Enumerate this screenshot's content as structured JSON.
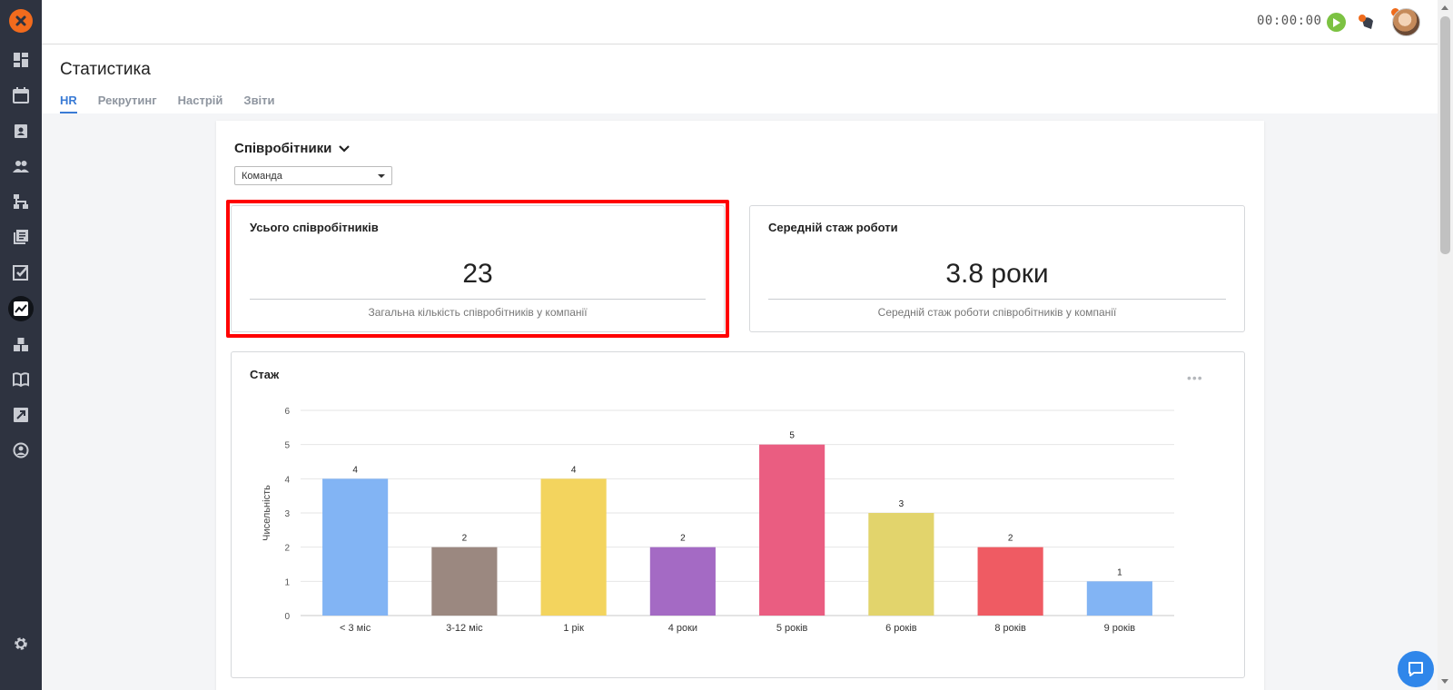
{
  "topbar": {
    "timer": "00:00:00"
  },
  "header": {
    "title": "Статистика",
    "tabs": [
      {
        "label": "HR",
        "active": true
      },
      {
        "label": "Рекрутинг",
        "active": false
      },
      {
        "label": "Настрій",
        "active": false
      },
      {
        "label": "Звіти",
        "active": false
      }
    ]
  },
  "filters": {
    "section_label": "Співробітники",
    "team_select_value": "Команда"
  },
  "stats": {
    "total": {
      "label": "Усього співробітників",
      "value": "23",
      "description": "Загальна кількість співробітників у компанії"
    },
    "avg_tenure": {
      "label": "Середній стаж роботи",
      "value": "3.8 роки",
      "description": "Середній стаж роботи співробітників у компанії"
    }
  },
  "chart_card": {
    "title": "Стаж",
    "more_label": "•••"
  },
  "chart_data": {
    "type": "bar",
    "title": "Стаж",
    "xlabel": "",
    "ylabel": "Чисельність",
    "ylim": [
      0,
      6
    ],
    "yticks": [
      0,
      1,
      2,
      3,
      4,
      5,
      6
    ],
    "grid": true,
    "data_labels": true,
    "categories": [
      "< 3 міс",
      "3-12 міс",
      "1 рік",
      "4 роки",
      "5 років",
      "6 років",
      "8 років",
      "9 років"
    ],
    "values": [
      4,
      2,
      4,
      2,
      5,
      3,
      2,
      1
    ],
    "colors": [
      "#82b4f4",
      "#9b8880",
      "#f3d45e",
      "#a46ac4",
      "#ea5d81",
      "#e2d46c",
      "#ef5b63",
      "#82b4f4"
    ]
  },
  "colors": {
    "sidebar": "#2e3340",
    "accent": "#3a7bd5",
    "logo": "#f26b1d",
    "play": "#7cc242",
    "highlight": "#ff0000",
    "chat": "#2f86ea"
  }
}
